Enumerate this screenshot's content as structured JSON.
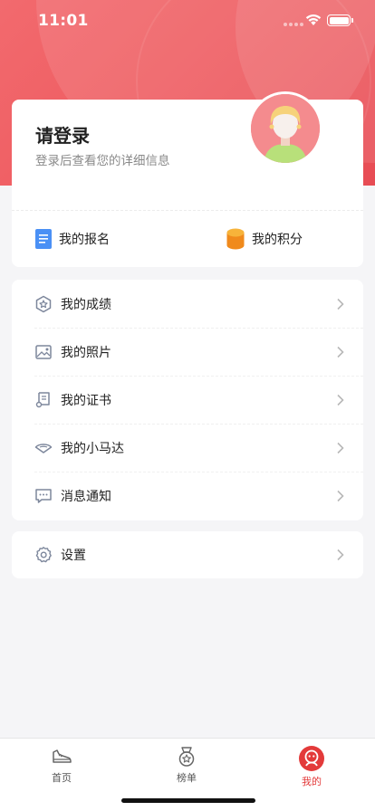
{
  "status_bar": {
    "time": "11:01"
  },
  "login_card": {
    "title": "请登录",
    "subtitle": "登录后查看您的详细信息",
    "quick_actions": [
      {
        "label": "我的报名",
        "icon": "document-icon"
      },
      {
        "label": "我的积分",
        "icon": "coins-icon"
      }
    ]
  },
  "menu": {
    "items": [
      {
        "label": "我的成绩",
        "icon": "medal-star-icon"
      },
      {
        "label": "我的照片",
        "icon": "photo-icon"
      },
      {
        "label": "我的证书",
        "icon": "certificate-icon"
      },
      {
        "label": "我的小马达",
        "icon": "motor-icon"
      },
      {
        "label": "消息通知",
        "icon": "message-icon"
      }
    ]
  },
  "settings": {
    "label": "设置",
    "icon": "gear-icon"
  },
  "tab_bar": {
    "tabs": [
      {
        "label": "首页",
        "icon": "sneaker-icon",
        "active": false
      },
      {
        "label": "榜单",
        "icon": "ranking-medal-icon",
        "active": false
      },
      {
        "label": "我的",
        "icon": "profile-icon",
        "active": true
      }
    ]
  },
  "colors": {
    "brand_red": "#ee5a5f",
    "active_tab": "#e33a3a",
    "doc_icon_blue": "#4a90f5",
    "coin_orange": "#f5a623"
  }
}
